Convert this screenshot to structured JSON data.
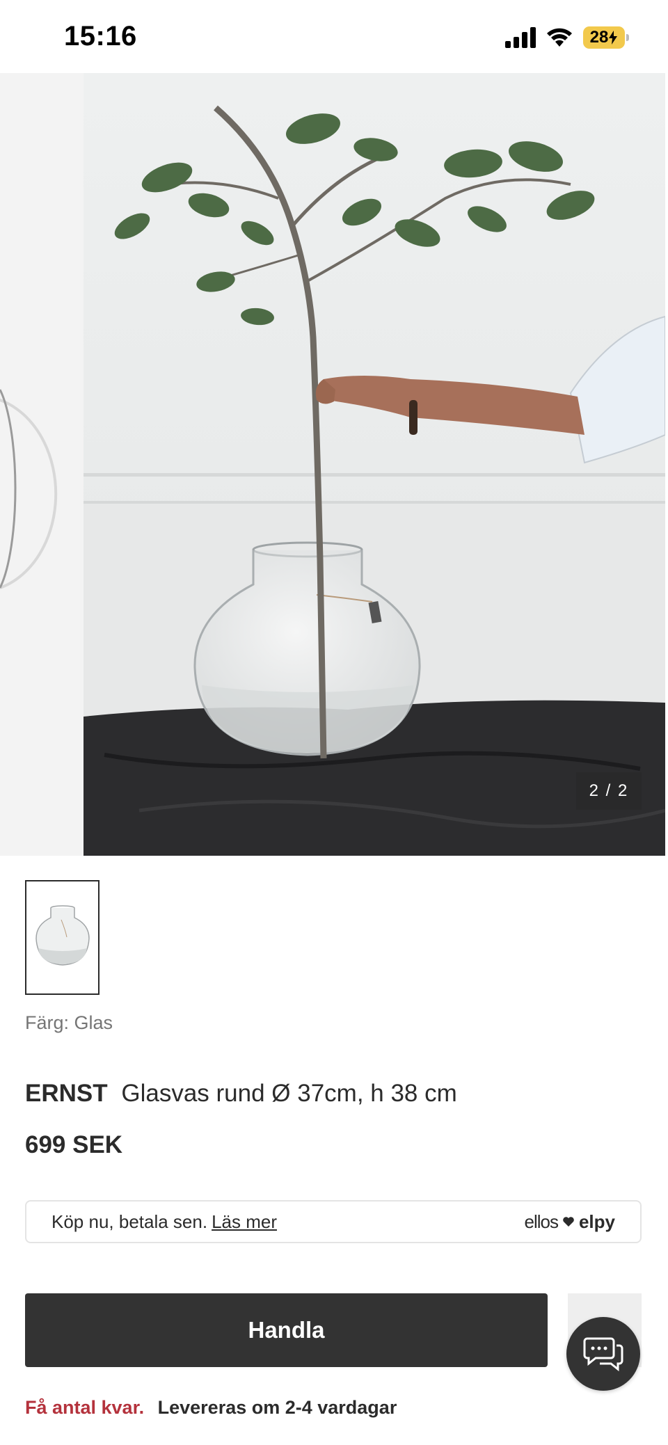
{
  "status_bar": {
    "time": "15:16",
    "battery": "28"
  },
  "carousel": {
    "counter": "2 / 2"
  },
  "product": {
    "color_label": "Färg: Glas",
    "brand": "ERNST",
    "name": "Glasvas rund Ø 37cm, h 38 cm",
    "price": "699 SEK"
  },
  "payment": {
    "text": "Köp nu, betala sen.",
    "link": "Läs mer",
    "logo_left": "ellos",
    "logo_right": "elpy"
  },
  "actions": {
    "buy_label": "Handla"
  },
  "availability": {
    "warning": "Få antal kvar.",
    "delivery": "Levereras om 2-4 vardagar"
  },
  "colors": {
    "accent_dark": "#333333",
    "warning_red": "#b4323c"
  },
  "icons": [
    "signal-icon",
    "wifi-icon",
    "battery-icon",
    "chat-icon",
    "heart-icon"
  ]
}
